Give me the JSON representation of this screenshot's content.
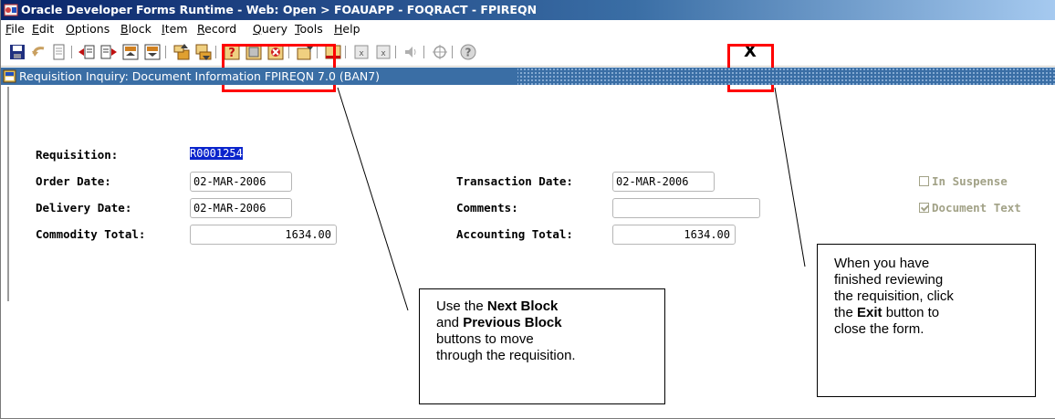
{
  "window": {
    "title": "Oracle Developer Forms Runtime - Web:  Open > FOAUAPP - FOQRACT - FPIREQN"
  },
  "menu": [
    {
      "label": "File"
    },
    {
      "label": "Edit"
    },
    {
      "label": "Options"
    },
    {
      "label": "Block"
    },
    {
      "label": "Item"
    },
    {
      "label": "Record"
    },
    {
      "label": "Query"
    },
    {
      "label": "Tools"
    },
    {
      "label": "Help"
    }
  ],
  "toolbar": {
    "exit_label": "X"
  },
  "form": {
    "title": "Requisition Inquiry: Document Information  FPIREQN  7.0  (BAN7)",
    "fields": {
      "requisition": {
        "label": "Requisition:",
        "value": "R0001254"
      },
      "order_date": {
        "label": "Order Date:",
        "value": "02-MAR-2006"
      },
      "delivery_date": {
        "label": "Delivery Date:",
        "value": "02-MAR-2006"
      },
      "commodity_total": {
        "label": "Commodity Total:",
        "value": "1634.00"
      },
      "transaction_date": {
        "label": "Transaction Date:",
        "value": "02-MAR-2006"
      },
      "comments": {
        "label": "Comments:",
        "value": ""
      },
      "accounting_total": {
        "label": "Accounting  Total:",
        "value": "1634.00"
      }
    },
    "checkboxes": {
      "in_suspense": {
        "label": "In Suspense",
        "checked": false
      },
      "document_text": {
        "label": "Document Text",
        "checked": true
      }
    }
  },
  "callouts": {
    "left": {
      "t1": "Use the ",
      "b1": "Next Block",
      "t2": "and ",
      "b2": "Previous Block",
      "t3": "buttons to move",
      "t4": "through the requisition."
    },
    "right": {
      "t1": "When you have",
      "t2": "finished reviewing",
      "t3": "the requisition, click",
      "t4": "the ",
      "b1": "Exit",
      "t5": " button to",
      "t6": "close the form."
    }
  },
  "colors": {
    "titlebar": "#0a246a",
    "formbar": "#3a6ea5",
    "highlight": "#ff0000",
    "selection": "#0a24cc",
    "disabled_text": "#a2a287"
  }
}
